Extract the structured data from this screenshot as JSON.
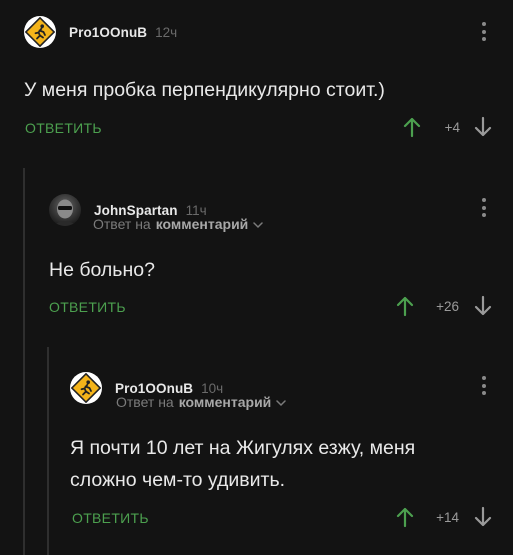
{
  "colors": {
    "background": "#131313",
    "accent_green": "#4ca04f",
    "text": "#e9e9e9",
    "muted": "#7b7b7b"
  },
  "comments": [
    {
      "username": "Pro1OOnuB",
      "time": "12ч",
      "avatar_icon": "running-man-sign-icon",
      "text_lines": [
        "У меня пробка перпендикулярно стоит.)"
      ],
      "reply_label": "ОТВЕТИТЬ",
      "rating": "+4"
    },
    {
      "username": "JohnSpartan",
      "time": "11ч",
      "avatar_icon": "user-photo-avatar",
      "reply_to_prefix": "Ответ на",
      "reply_to_target": "комментарий",
      "text_lines": [
        "Не больно?"
      ],
      "reply_label": "ОТВЕТИТЬ",
      "rating": "+26"
    },
    {
      "username": "Pro1OOnuB",
      "time": "10ч",
      "avatar_icon": "running-man-sign-icon",
      "reply_to_prefix": "Ответ на",
      "reply_to_target": "комментарий",
      "text_lines": [
        "Я почти 10 лет на Жигулях езжу, меня",
        "сложно чем-то удивить."
      ],
      "reply_label": "ОТВЕТИТЬ",
      "rating": "+14"
    }
  ]
}
